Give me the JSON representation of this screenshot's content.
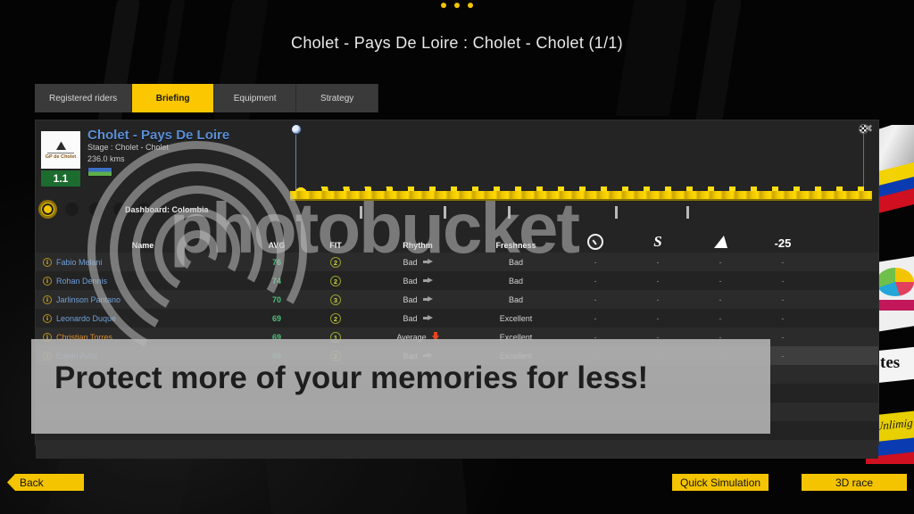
{
  "window": {
    "title": "Cholet - Pays De Loire : Cholet - Cholet (1/1)",
    "top_dots": [
      "dot",
      "dot",
      "dot"
    ],
    "close_label": "✖",
    "accent_color": "#f5c400",
    "panel_color": "#242424"
  },
  "tabs": [
    {
      "label": "Registered riders",
      "active": false
    },
    {
      "label": "Briefing",
      "active": true
    },
    {
      "label": "Equipment",
      "active": false
    },
    {
      "label": "Strategy",
      "active": false
    }
  ],
  "race": {
    "name": "Cholet - Pays De Loire",
    "stage": "Stage : Cholet - Cholet",
    "distance": "236.0 kms",
    "category": "1.1",
    "logo_text": "GP de Cholet",
    "logo_glyph": "⛰",
    "flag_name": "race-flag"
  },
  "dashboard": {
    "label": "Dashboard: Colombia",
    "dots_total": 5,
    "dots_active_index": 0
  },
  "profile": {
    "start_marker": "start-flag-icon",
    "finish_marker": "finish-flag-icon",
    "km_ticks": 5
  },
  "table": {
    "columns": [
      {
        "key": "name",
        "label": "Name"
      },
      {
        "key": "avg",
        "label": "AVG"
      },
      {
        "key": "fit",
        "label": "FIT"
      },
      {
        "key": "rhythm",
        "label": "Rhythm"
      },
      {
        "key": "fresh",
        "label": "Freshness"
      },
      {
        "key": "sprint",
        "label": "",
        "icon": "speedometer-icon"
      },
      {
        "key": "flat",
        "label": "",
        "icon": "lightning-s-icon"
      },
      {
        "key": "mtn",
        "label": "",
        "icon": "mountain-icon"
      },
      {
        "key": "minus25",
        "label": "-25",
        "icon": "minus-25-icon"
      }
    ],
    "rows": [
      {
        "name": "Fabio Melani",
        "avg": "76",
        "fit": "2",
        "rhythm": "Bad",
        "rhythm_trend": "flat",
        "fresh": "Bad",
        "sprint": "-",
        "flat": "-",
        "mtn": "-",
        "minus25": "-",
        "highlight": false
      },
      {
        "name": "Rohan Dennis",
        "avg": "74",
        "fit": "2",
        "rhythm": "Bad",
        "rhythm_trend": "flat",
        "fresh": "Bad",
        "sprint": "-",
        "flat": "-",
        "mtn": "-",
        "minus25": "-",
        "highlight": false
      },
      {
        "name": "Jarlinson Pantano",
        "avg": "70",
        "fit": "3",
        "rhythm": "Bad",
        "rhythm_trend": "flat",
        "fresh": "Bad",
        "sprint": "-",
        "flat": "-",
        "mtn": "-",
        "minus25": "-",
        "highlight": false
      },
      {
        "name": "Leonardo Duque",
        "avg": "69",
        "fit": "2",
        "rhythm": "Bad",
        "rhythm_trend": "flat",
        "fresh": "Excellent",
        "sprint": "-",
        "flat": "-",
        "mtn": "-",
        "minus25": "-",
        "highlight": false
      },
      {
        "name": "Christian Torres",
        "avg": "69",
        "fit": "1",
        "rhythm": "Average",
        "rhythm_trend": "down",
        "fresh": "Excellent",
        "sprint": "-",
        "flat": "-",
        "mtn": "-",
        "minus25": "-",
        "highlight": true
      },
      {
        "name": "Edwin Avila",
        "avg": "69",
        "fit": "2",
        "rhythm": "Bad",
        "rhythm_trend": "flat",
        "fresh": "Excellent",
        "sprint": "-",
        "flat": "-",
        "mtn": "-",
        "minus25": "-",
        "highlight": false
      }
    ],
    "empty_rows": 5
  },
  "watermark": {
    "brand": "photobucket",
    "tagline": "Protect more of your memories for less!"
  },
  "footer": {
    "back": "Back",
    "quick_simulation": "Quick Simulation",
    "race_3d": "3D race"
  },
  "jersey": {
    "sponsor_text": "tes",
    "script_text": "Unlimig"
  }
}
